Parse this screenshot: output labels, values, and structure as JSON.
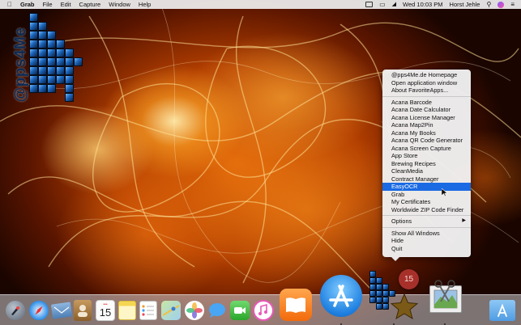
{
  "menubar": {
    "apple_icon": "apple-icon",
    "app_name": "Grab",
    "menus": [
      "File",
      "Edit",
      "Capture",
      "Window",
      "Help"
    ],
    "clock": "Wed 10:03 PM",
    "user": "Horst Jehle",
    "status_icons": [
      "display-icon",
      "airplay-icon",
      "wifi-icon",
      "search-icon",
      "siri-icon",
      "list-icon"
    ]
  },
  "logo": {
    "text": "@pps4Me"
  },
  "context_menu": {
    "group1": [
      "@pps4Me.de Homepage",
      "Open application window",
      "About FavoriteApps..."
    ],
    "group2": [
      "Acana Barcode",
      "Acana Date Calculator",
      "Acana License Manager",
      "Acana Map2Pin",
      "Acana My Books",
      "Acana QR Code Generator",
      "Acana Screen Capture",
      "App Store",
      "Brewing Recipes",
      "CleanMedia",
      "Contract Manager",
      "EasyOCR",
      "Grab",
      "My Certificates",
      "Worldwide ZIP Code Finder"
    ],
    "selected": "EasyOCR",
    "options_label": "Options",
    "group3": [
      "Show All Windows",
      "Hide",
      "Quit"
    ]
  },
  "dock": {
    "badge": "15",
    "calendar_day": "15",
    "items": [
      "launchpad-icon",
      "safari-icon",
      "mail-icon",
      "contacts-icon",
      "calendar-icon",
      "notes-icon",
      "reminders-icon",
      "maps-icon",
      "photos-icon",
      "messages-icon",
      "facetime-icon",
      "itunes-icon",
      "ibooks-icon",
      "app-store-icon",
      "favoriteapps-icon",
      "grab-icon",
      "downloads-stack-icon"
    ]
  },
  "colors": {
    "selection": "#1a6ae3",
    "badge": "#a8302a",
    "logo_text": "#0e2a52"
  }
}
